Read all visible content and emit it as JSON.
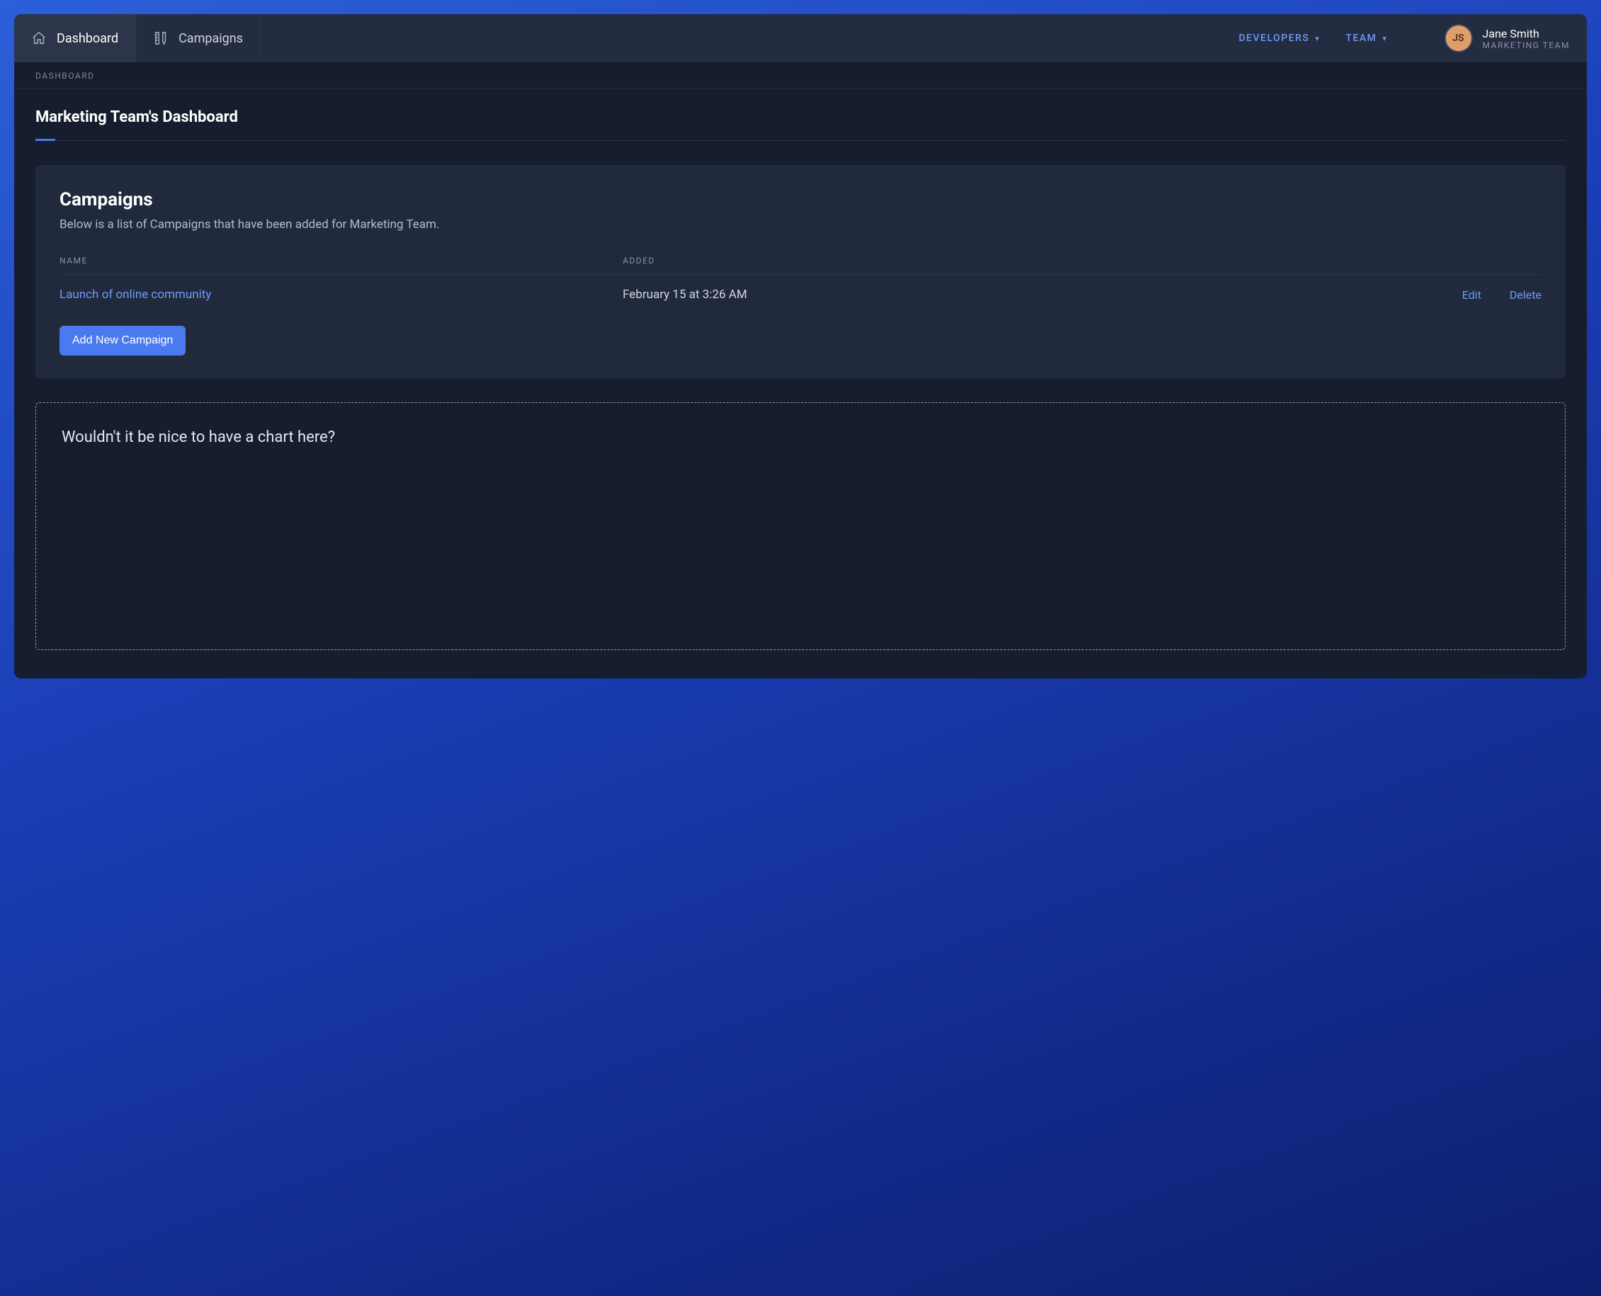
{
  "nav": {
    "tabs": [
      {
        "label": "Dashboard",
        "icon": "house-icon",
        "active": true
      },
      {
        "label": "Campaigns",
        "icon": "ruler-pencil-icon",
        "active": false
      }
    ]
  },
  "top_links": [
    {
      "label": "DEVELOPERS"
    },
    {
      "label": "TEAM"
    }
  ],
  "user": {
    "initials": "JS",
    "name": "Jane Smith",
    "team": "MARKETING TEAM"
  },
  "breadcrumb": "DASHBOARD",
  "page_title": "Marketing Team's Dashboard",
  "campaigns_card": {
    "title": "Campaigns",
    "subtitle": "Below is a list of Campaigns that have been added for Marketing Team.",
    "columns": {
      "name": "Name",
      "added": "Added"
    },
    "rows": [
      {
        "name": "Launch of online community",
        "added": "February 15 at 3:26 AM"
      }
    ],
    "actions": {
      "edit": "Edit",
      "delete": "Delete"
    },
    "add_button": "Add New Campaign"
  },
  "placeholder": {
    "text": "Wouldn't it be nice to have a chart here?"
  }
}
